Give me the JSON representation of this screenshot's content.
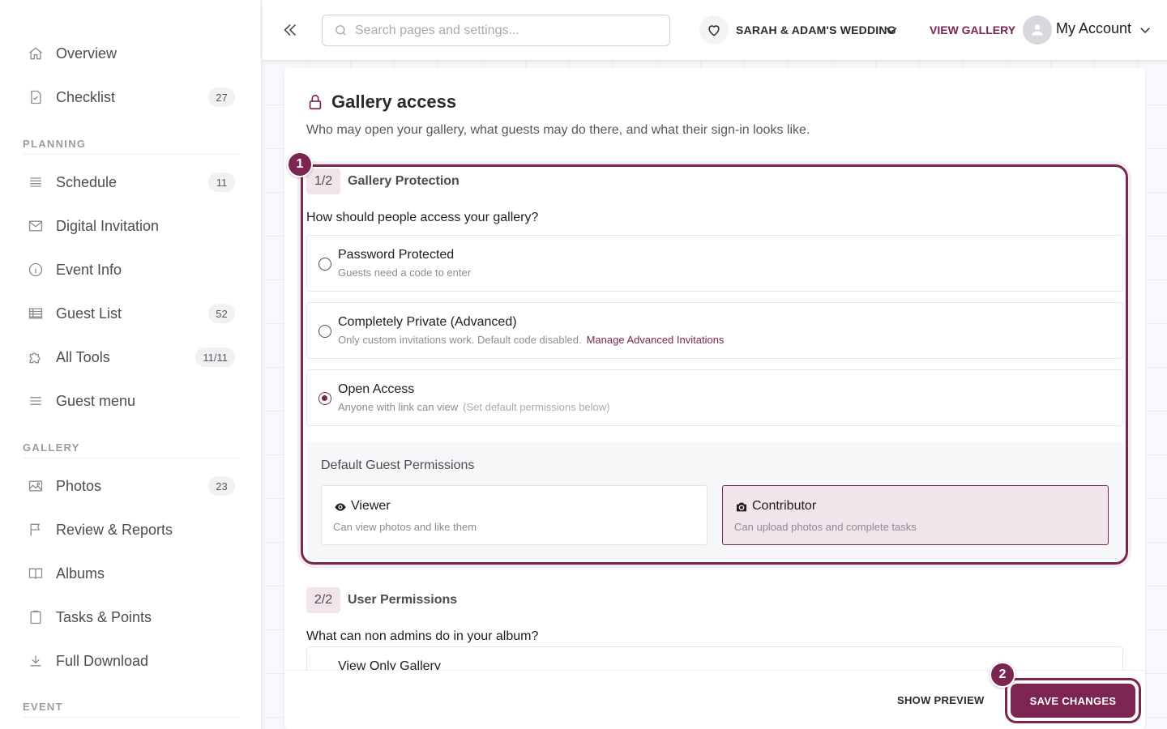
{
  "colors": {
    "accent": "#7b2550",
    "accent_soft": "#f1e4ea"
  },
  "sidebar": {
    "items_top": [
      {
        "label": "Overview",
        "icon": "home-icon"
      },
      {
        "label": "Checklist",
        "icon": "checklist-icon",
        "badge": "27"
      }
    ],
    "planning_label": "PLANNING",
    "planning_items": [
      {
        "label": "Schedule",
        "icon": "schedule-icon",
        "badge": "11"
      },
      {
        "label": "Digital Invitation",
        "icon": "mail-icon"
      },
      {
        "label": "Event Info",
        "icon": "info-icon"
      },
      {
        "label": "Guest List",
        "icon": "table-icon",
        "badge": "52"
      },
      {
        "label": "All Tools",
        "icon": "puzzle-icon",
        "badge": "11/11"
      },
      {
        "label": "Guest menu",
        "icon": "menu-icon"
      }
    ],
    "gallery_label": "GALLERY",
    "gallery_items": [
      {
        "label": "Photos",
        "icon": "image-icon",
        "badge": "23"
      },
      {
        "label": "Review & Reports",
        "icon": "flag-icon"
      },
      {
        "label": "Albums",
        "icon": "book-icon"
      },
      {
        "label": "Tasks & Points",
        "icon": "clipboard-icon"
      },
      {
        "label": "Full Download",
        "icon": "download-icon"
      }
    ],
    "event_label": "EVENT"
  },
  "topbar": {
    "search_placeholder": "Search pages and settings...",
    "event_name": "SARAH & ADAM'S WEDDING",
    "view_gallery": "VIEW GALLERY",
    "account": "My Account"
  },
  "card": {
    "title": "Gallery access",
    "subtitle": "Who may open your gallery, what guests may do there, and what their sign-in looks like.",
    "step1": {
      "pill": "1/2",
      "title": "Gallery Protection",
      "question": "How should people access your gallery?",
      "options": [
        {
          "title": "Password Protected",
          "desc": "Guests need a code to enter",
          "selected": false
        },
        {
          "title": "Completely Private (Advanced)",
          "desc": "Only custom invitations work. Default code disabled.",
          "link": "Manage Advanced Invitations",
          "selected": false
        },
        {
          "title": "Open Access",
          "desc": "Anyone with link can view",
          "note": "(Set default permissions below)",
          "selected": true
        }
      ],
      "permissions_label": "Default Guest Permissions",
      "permissions": [
        {
          "title": "Viewer",
          "desc": "Can view photos and like them",
          "icon": "eye-icon",
          "selected": false
        },
        {
          "title": "Contributor",
          "desc": "Can upload photos and complete tasks",
          "icon": "camera-icon",
          "selected": true
        }
      ]
    },
    "step2": {
      "pill": "2/2",
      "title": "User Permissions",
      "question": "What can non admins do in your album?",
      "first_option": "View Only Gallery"
    },
    "markers": [
      "1",
      "2"
    ]
  },
  "footer": {
    "show_preview": "SHOW PREVIEW",
    "save": "SAVE CHANGES"
  }
}
